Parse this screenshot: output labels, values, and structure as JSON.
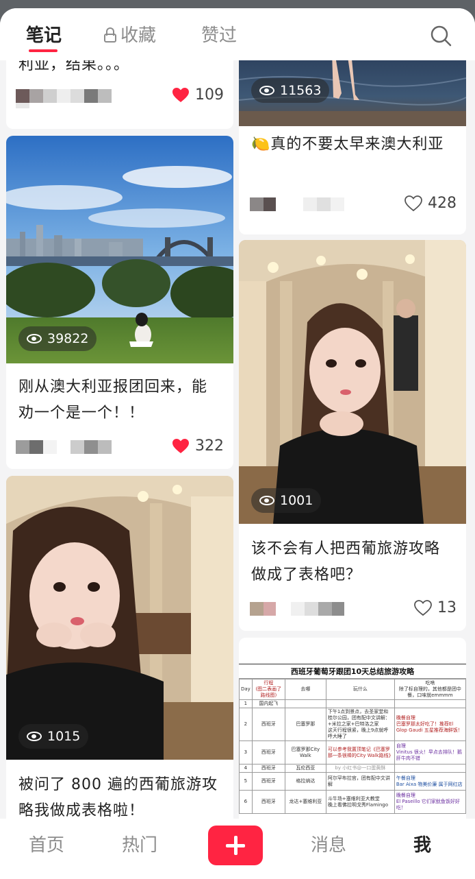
{
  "header": {
    "tabs": [
      "笔记",
      "收藏",
      "赞过"
    ],
    "active_tab": "笔记"
  },
  "cards": [
    {
      "id": "c1",
      "title": "利亚，结果。。。",
      "likes": "109",
      "liked": true
    },
    {
      "id": "c2",
      "views": "11563",
      "title_emoji": "🍋",
      "title": "真的不要太早来澳大利亚",
      "likes": "428",
      "liked": false
    },
    {
      "id": "c3",
      "views": "39822",
      "title": "刚从澳大利亚报团回来，能劝一个是一个！！",
      "likes": "322",
      "liked": true
    },
    {
      "id": "c4",
      "views": "1001",
      "title": "该不会有人把西葡旅游攻略做成了表格吧？",
      "likes": "13",
      "liked": false
    },
    {
      "id": "c5",
      "views": "1015",
      "title": "被问了 800 遍的西葡旅游攻略我做成表格啦！"
    },
    {
      "id": "c6"
    }
  ],
  "table_image": {
    "title": "西班牙葡萄牙跟团10天总结旅游攻略",
    "headers": [
      "Day",
      "行程\n(图二表画了路线图)",
      "去哪",
      "玩什么",
      "吃啥\n除了标自理的，其他都是团中餐，口味就emmmm"
    ],
    "rows": [
      [
        "1",
        "国内起飞",
        "",
        "",
        ""
      ],
      [
        "2",
        "西班牙",
        "巴塞罗那",
        "下午1点到景点，去圣家堂和桂尔公园，团有配中文讲解：+米拉之家+巴特洛之家\n这天行程很紧，晚上9点就呼呼大睡了",
        "晚餐自理\n巴塞罗那太好吃了！推荐El Glop Gaudi 五星推荐海鲜饭！"
      ],
      [
        "3",
        "西班牙",
        "巴塞罗那City Walk",
        "可以参考我置顶笔记《巴塞罗那一条很棒的City Walk路线》",
        "自理\nVinitus 很火！早点去排队！鹅肝牛肉不错"
      ],
      [
        "4",
        "西班牙",
        "瓦伦西亚",
        "by 小红书@一口蛋黄酥",
        ""
      ],
      [
        "5",
        "西班牙",
        "格拉纳达",
        "阿尔罕布拉宫，团有配中文讲解",
        "午餐自理\nBar Aixa 物美价廉 属于网红店"
      ],
      [
        "6",
        "西班牙",
        "龙达+塞维利亚",
        "斗牛场+塞维利亚大教堂\n晚上看佛拉明戈秀Flamingo",
        "晚餐自理\nEl Paseillo 它们家鱿鱼饭好好吃！"
      ]
    ]
  },
  "nav": {
    "items": [
      "首页",
      "热门",
      "消息",
      "我"
    ],
    "active": "我"
  },
  "colors": {
    "accent": "#ff2442",
    "background": "#f4f4f5",
    "card": "#ffffff",
    "text": "#222222",
    "muted": "#8c8c8c"
  },
  "icons": [
    "lock-icon",
    "search-icon",
    "eye-icon",
    "heart-filled-icon",
    "heart-outline-icon",
    "plus-icon"
  ]
}
